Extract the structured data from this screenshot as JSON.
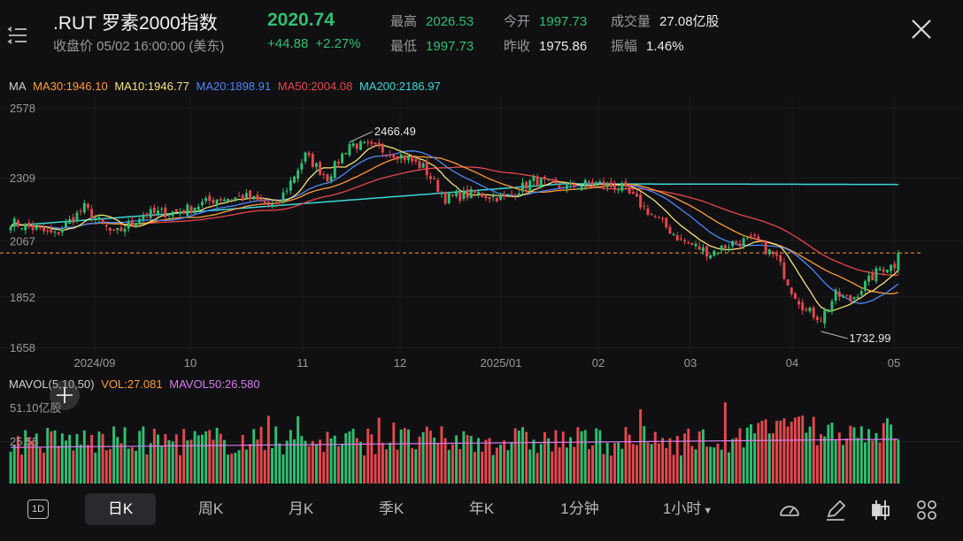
{
  "header": {
    "symbol": ".RUT",
    "name": "罗素2000指数",
    "price": "2020.74",
    "close_info": "收盘价 05/02 16:00:00 (美东)",
    "change": "+44.88",
    "change_pct": "+2.27%",
    "stats": [
      {
        "label": "最高",
        "value": "2026.53",
        "color": "#2fbf71"
      },
      {
        "label": "今开",
        "value": "1997.73",
        "color": "#2fbf71"
      },
      {
        "label": "成交量",
        "value": "27.08亿股",
        "color": "#eaeaea"
      },
      {
        "label": "最低",
        "value": "1997.73",
        "color": "#2fbf71"
      },
      {
        "label": "昨收",
        "value": "1975.86",
        "color": "#eaeaea"
      },
      {
        "label": "振幅",
        "value": "1.46%",
        "color": "#eaeaea"
      }
    ]
  },
  "ma_legend": {
    "prefix": "MA",
    "items": [
      {
        "text": "MA30:1946.10",
        "color": "#ff9b3d"
      },
      {
        "text": "MA10:1946.77",
        "color": "#f6e27a"
      },
      {
        "text": "MA20:1898.91",
        "color": "#4f86f7"
      },
      {
        "text": "MA50:2004.08",
        "color": "#e5484d"
      },
      {
        "text": "MA200:2186.97",
        "color": "#3fd6d6"
      }
    ]
  },
  "vol_legend": {
    "prefix": "MAVOL(5,10,50)",
    "items": [
      {
        "text": "VOL:27.081",
        "color": "#ff9b3d"
      },
      {
        "text": "MAVOL50:26.580",
        "color": "#d97bf0"
      }
    ]
  },
  "toolbar": {
    "badge": "1D",
    "tabs": [
      "日K",
      "周K",
      "月K",
      "季K",
      "年K",
      "1分钟",
      "1小时"
    ],
    "active": "日K"
  },
  "chart_data": {
    "type": "candlestick",
    "price_axis": {
      "ticks": [
        "2578",
        "2309",
        "2067",
        "1852",
        "1658"
      ],
      "range": [
        1658,
        2578
      ]
    },
    "x_labels": [
      "2024/09",
      "10",
      "11",
      "12",
      "2025/01",
      "02",
      "03",
      "04",
      "05"
    ],
    "annotations": {
      "high": "2466.49",
      "low": "1732.99"
    },
    "last_close": 2020.74,
    "ohlc_keypoints": [
      {
        "i": 0,
        "c": 2140
      },
      {
        "i": 12,
        "c": 2090
      },
      {
        "i": 20,
        "c": 2195
      },
      {
        "i": 28,
        "c": 2090
      },
      {
        "i": 36,
        "c": 2170
      },
      {
        "i": 46,
        "c": 2180
      },
      {
        "i": 56,
        "c": 2230
      },
      {
        "i": 64,
        "c": 2235
      },
      {
        "i": 72,
        "c": 2195
      },
      {
        "i": 80,
        "c": 2395
      },
      {
        "i": 86,
        "c": 2310
      },
      {
        "i": 92,
        "c": 2440
      },
      {
        "i": 100,
        "c": 2420
      },
      {
        "i": 106,
        "c": 2395
      },
      {
        "i": 112,
        "c": 2350
      },
      {
        "i": 118,
        "c": 2230
      },
      {
        "i": 126,
        "c": 2250
      },
      {
        "i": 134,
        "c": 2230
      },
      {
        "i": 142,
        "c": 2300
      },
      {
        "i": 150,
        "c": 2270
      },
      {
        "i": 158,
        "c": 2290
      },
      {
        "i": 166,
        "c": 2270
      },
      {
        "i": 174,
        "c": 2170
      },
      {
        "i": 182,
        "c": 2070
      },
      {
        "i": 190,
        "c": 2020
      },
      {
        "i": 196,
        "c": 2060
      },
      {
        "i": 202,
        "c": 2070
      },
      {
        "i": 208,
        "c": 2000
      },
      {
        "i": 212,
        "c": 1880
      },
      {
        "i": 216,
        "c": 1800
      },
      {
        "i": 220,
        "c": 1770
      },
      {
        "i": 224,
        "c": 1860
      },
      {
        "i": 228,
        "c": 1840
      },
      {
        "i": 232,
        "c": 1900
      },
      {
        "i": 236,
        "c": 1960
      },
      {
        "i": 240,
        "c": 1975
      },
      {
        "i": 241,
        "c": 2020.74
      }
    ],
    "volume_axis": {
      "ticks": [
        "51.10亿股",
        "25.55"
      ]
    }
  }
}
